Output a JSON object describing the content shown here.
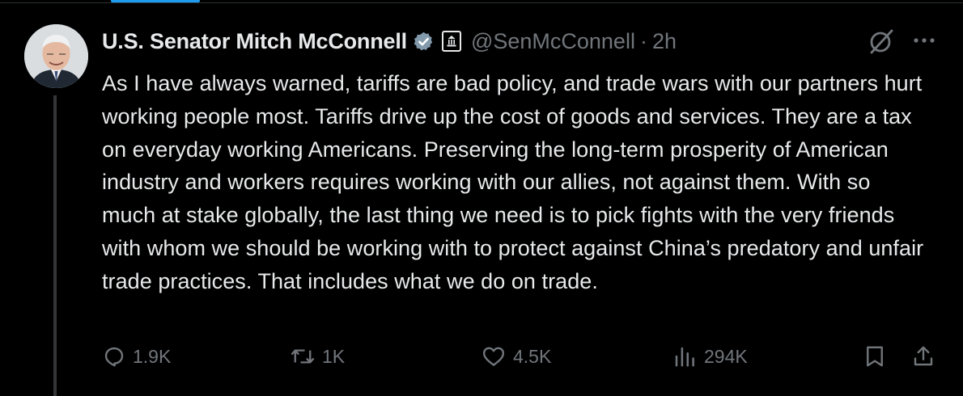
{
  "tweet": {
    "author": {
      "display_name": "U.S. Senator Mitch McConnell",
      "handle": "@SenMcConnell",
      "verified": true,
      "badge": "government-badge-icon"
    },
    "separator": "·",
    "timestamp": "2h",
    "text": "As I have always warned, tariffs are bad policy, and trade wars with our partners hurt working people most. Tariffs drive up the cost of goods and services. They are a tax on everyday working Americans. Preserving the long-term prosperity of American industry and workers requires working with our allies, not against them. With so much at stake globally, the last thing we need is to pick fights with the very friends with whom we should be working with to protect against China’s predatory and unfair trade practices. That includes what we do on trade.",
    "stats": {
      "replies": "1.9K",
      "reposts": "1K",
      "likes": "4.5K",
      "views": "294K"
    }
  },
  "colors": {
    "background": "#000000",
    "primary_text": "#e7e9ea",
    "secondary_text": "#71767b",
    "verified_badge": "#829aab",
    "accent": "#1d9bf0",
    "divider": "#2f3336"
  },
  "icons": [
    "verified-icon",
    "government-badge-icon",
    "grok-icon",
    "more-icon",
    "reply-icon",
    "repost-icon",
    "like-icon",
    "views-icon",
    "bookmark-icon",
    "share-icon"
  ]
}
